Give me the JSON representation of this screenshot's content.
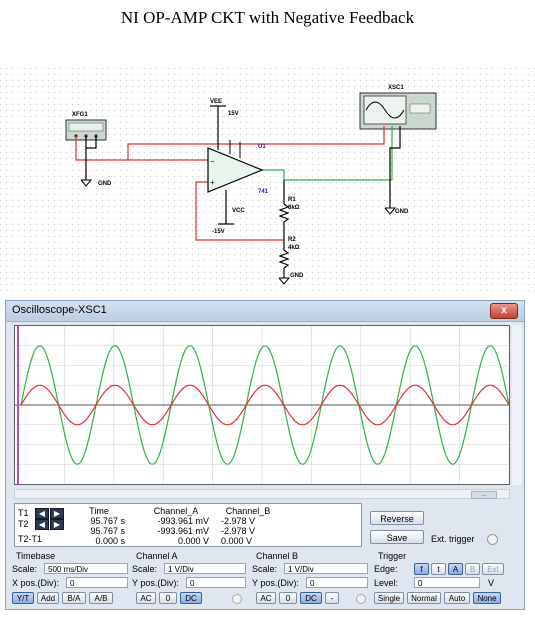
{
  "page": {
    "title": "NI OP-AMP CKT with Negative Feedback"
  },
  "schematic": {
    "xfg": "XFG1",
    "xsc": "XSC1",
    "vee": "VEE",
    "vee_val": "15V",
    "vcc": "VCC",
    "vcc_val": "-15V",
    "u1": "U1",
    "opamp_model": "741",
    "r1": "R1",
    "r1_val": "8kΩ",
    "r2": "R2",
    "r2_val": "4kΩ",
    "gnd_left": "GND",
    "gnd_right": "GND",
    "gnd_bottom": "GND",
    "wire_colors": {
      "red": "#e0303a",
      "green": "#2fb34a",
      "black": "#000000"
    }
  },
  "oscilloscope": {
    "window_title": "Oscilloscope-XSC1",
    "close_label": "x",
    "scroll_label": "...",
    "plot": {
      "cycles": 6.5,
      "channel_a_amplitude_div": 1.0,
      "channel_b_amplitude_div": 3.0,
      "channel_a_color": "#e0303a",
      "channel_b_color": "#2fb34a",
      "cursor_color": "#c04ac0"
    },
    "readout": {
      "t1_label": "T1",
      "t2_label": "T2",
      "t2t1_label": "T2-T1",
      "headers": {
        "time": "Time",
        "channel_a": "Channel_A",
        "channel_b": "Channel_B"
      },
      "rows": [
        {
          "time": "95.767 s",
          "a": "-993.961 mV",
          "b": "-2.978 V"
        },
        {
          "time": "95.767 s",
          "a": "-993.961 mV",
          "b": "-2.978 V"
        },
        {
          "time": "0.000 s",
          "a": "0.000 V",
          "b": "0.000 V"
        }
      ]
    },
    "buttons": {
      "reverse": "Reverse",
      "save": "Save",
      "ext_trigger": "Ext. trigger"
    },
    "timebase": {
      "title": "Timebase",
      "scale_label": "Scale:",
      "scale_value": "500 ms/Div",
      "xpos_label": "X pos.(Div):",
      "xpos_value": "0",
      "modes": [
        "Y/T",
        "Add",
        "B/A",
        "A/B"
      ]
    },
    "channel_a": {
      "title": "Channel A",
      "scale_label": "Scale:",
      "scale_value": "1 V/Div",
      "ypos_label": "Y pos.(Div):",
      "ypos_value": "0",
      "coupling": [
        "AC",
        "0",
        "DC"
      ]
    },
    "channel_b": {
      "title": "Channel B",
      "scale_label": "Scale:",
      "scale_value": "1 V/Div",
      "ypos_label": "Y pos.(Div):",
      "ypos_value": "0",
      "coupling": [
        "AC",
        "0",
        "DC",
        "-"
      ]
    },
    "trigger": {
      "title": "Trigger",
      "edge_label": "Edge:",
      "level_label": "Level:",
      "level_value": "0",
      "level_unit": "V",
      "edge_buttons": [
        "f",
        "t",
        "A",
        "B",
        "Ext"
      ],
      "modes": [
        "Single",
        "Normal",
        "Auto",
        "None"
      ]
    }
  }
}
